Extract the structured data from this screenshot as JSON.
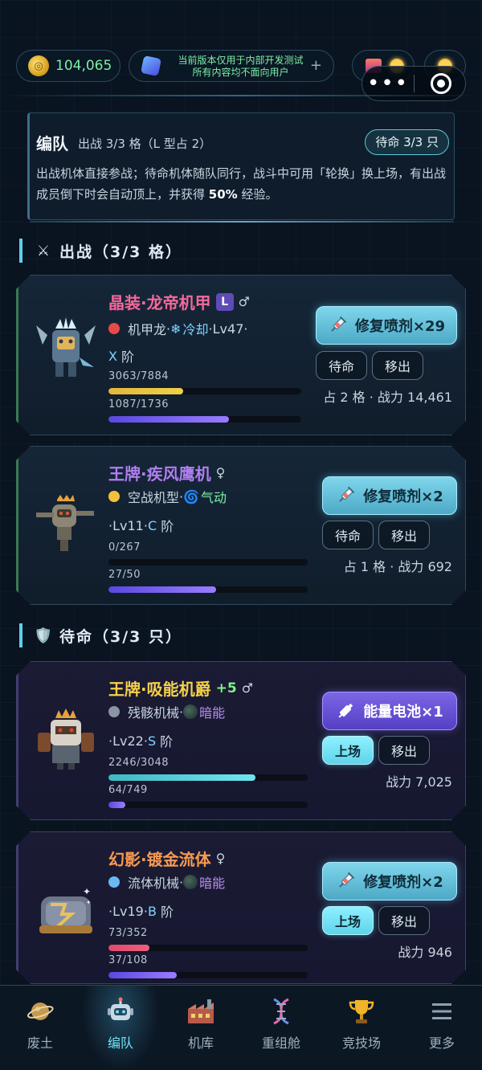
{
  "topbar": {
    "coins": "104,065",
    "notice_line1": "当前版本仅用于内部开发测试",
    "notice_line2": "所有内容均不面向用户",
    "notice_plus": "+"
  },
  "info": {
    "title": "编队",
    "subtitle": "出战 3/3 格（L 型占 2）",
    "badge": "待命 3/3 只",
    "desc_part1": "出战机体直接参战；待命机体随队同行，战斗中可用「轮换」换上场，有出战成员倒下时会自动顶上，并获得 ",
    "desc_bold": "50%",
    "desc_part2": " 经验。"
  },
  "sections": {
    "active": {
      "icon": "⚔",
      "label": "出战（3/3 格）"
    },
    "reserve": {
      "icon": "🛡️",
      "label": "待命（3/3 只）"
    }
  },
  "units": [
    {
      "name": "晶装·龙帝机甲",
      "name_color": "#f4699a",
      "tag": "L",
      "gender": "♂",
      "type_dot": "#e84a4a",
      "type": "机甲龙",
      "sep": " · ",
      "element_icon": "❄",
      "element": "冷却",
      "element_color": "#7fd4ff",
      "level": "Lv47",
      "rank_prefix": "X",
      "rank_suffix": " 阶",
      "hp": "3063/7884",
      "hp_ratio": 0.389,
      "hp_color": "linear-gradient(90deg,#e2b63a,#f0d04a)",
      "exp": "1087/1736",
      "exp_ratio": 0.626,
      "action": "修复喷剂×29",
      "action_type": "heal",
      "btn_a": "待命",
      "btn_b": "移出",
      "stat": "占 2 格 · 战力 14,461"
    },
    {
      "name": "王牌·疾风鹰机",
      "name_color": "#b07ef0",
      "gender": "♀",
      "type_dot": "#f2c23c",
      "type": "空战机型",
      "sep": " · ",
      "element_icon": "🌀",
      "element": "气动",
      "element_color": "#7ef0a6",
      "level": "Lv11",
      "rank_prefix": "C",
      "rank_suffix": " 阶",
      "hp": "0/267",
      "hp_ratio": 0,
      "hp_color": "linear-gradient(90deg,#e2b63a,#f0d04a)",
      "exp": "27/50",
      "exp_ratio": 0.54,
      "action": "修复喷剂×2",
      "action_type": "heal",
      "btn_a": "待命",
      "btn_b": "移出",
      "stat": "占 1 格 · 战力 692"
    },
    {
      "name": "王牌·吸能机爵",
      "name_color": "#f4d04a",
      "plus": "+5",
      "gender": "♂",
      "type_dot": "#8a96a2",
      "type": "残骸机械",
      "sep": " · ",
      "element_icon": "●",
      "element": "暗能",
      "element_color": "#b98ef0",
      "level": "Lv22",
      "rank_prefix": "S",
      "rank_suffix": " 阶",
      "hp": "2246/3048",
      "hp_ratio": 0.737,
      "hp_color": "linear-gradient(90deg,#3fb7c4,#6fe6ef)",
      "exp": "64/749",
      "exp_ratio": 0.085,
      "action": "能量电池×1",
      "action_type": "energy",
      "btn_a": "上场",
      "btn_b": "移出",
      "stat": "战力 7,025"
    },
    {
      "name": "幻影·镀金流体",
      "name_color": "#f59a52",
      "gender": "♀",
      "type_dot": "#6ab8f0",
      "type": "流体机械",
      "sep": " · ",
      "element_icon": "●",
      "element": "暗能",
      "element_color": "#b98ef0",
      "level": "Lv19",
      "rank_prefix": "B",
      "rank_suffix": " 阶",
      "hp": "73/352",
      "hp_ratio": 0.207,
      "hp_color": "linear-gradient(90deg,#e04a6a,#f0607a)",
      "exp": "37/108",
      "exp_ratio": 0.343,
      "action": "修复喷剂×2",
      "action_type": "heal",
      "btn_a": "上场",
      "btn_b": "移出",
      "stat": "战力 946"
    }
  ],
  "nav": [
    {
      "label": "废土",
      "icon": "planet-icon"
    },
    {
      "label": "编队",
      "icon": "robot-icon",
      "active": true
    },
    {
      "label": "机库",
      "icon": "factory-icon"
    },
    {
      "label": "重组舱",
      "icon": "dna-icon"
    },
    {
      "label": "竞技场",
      "icon": "trophy-icon"
    },
    {
      "label": "更多",
      "icon": "menu-icon"
    }
  ]
}
